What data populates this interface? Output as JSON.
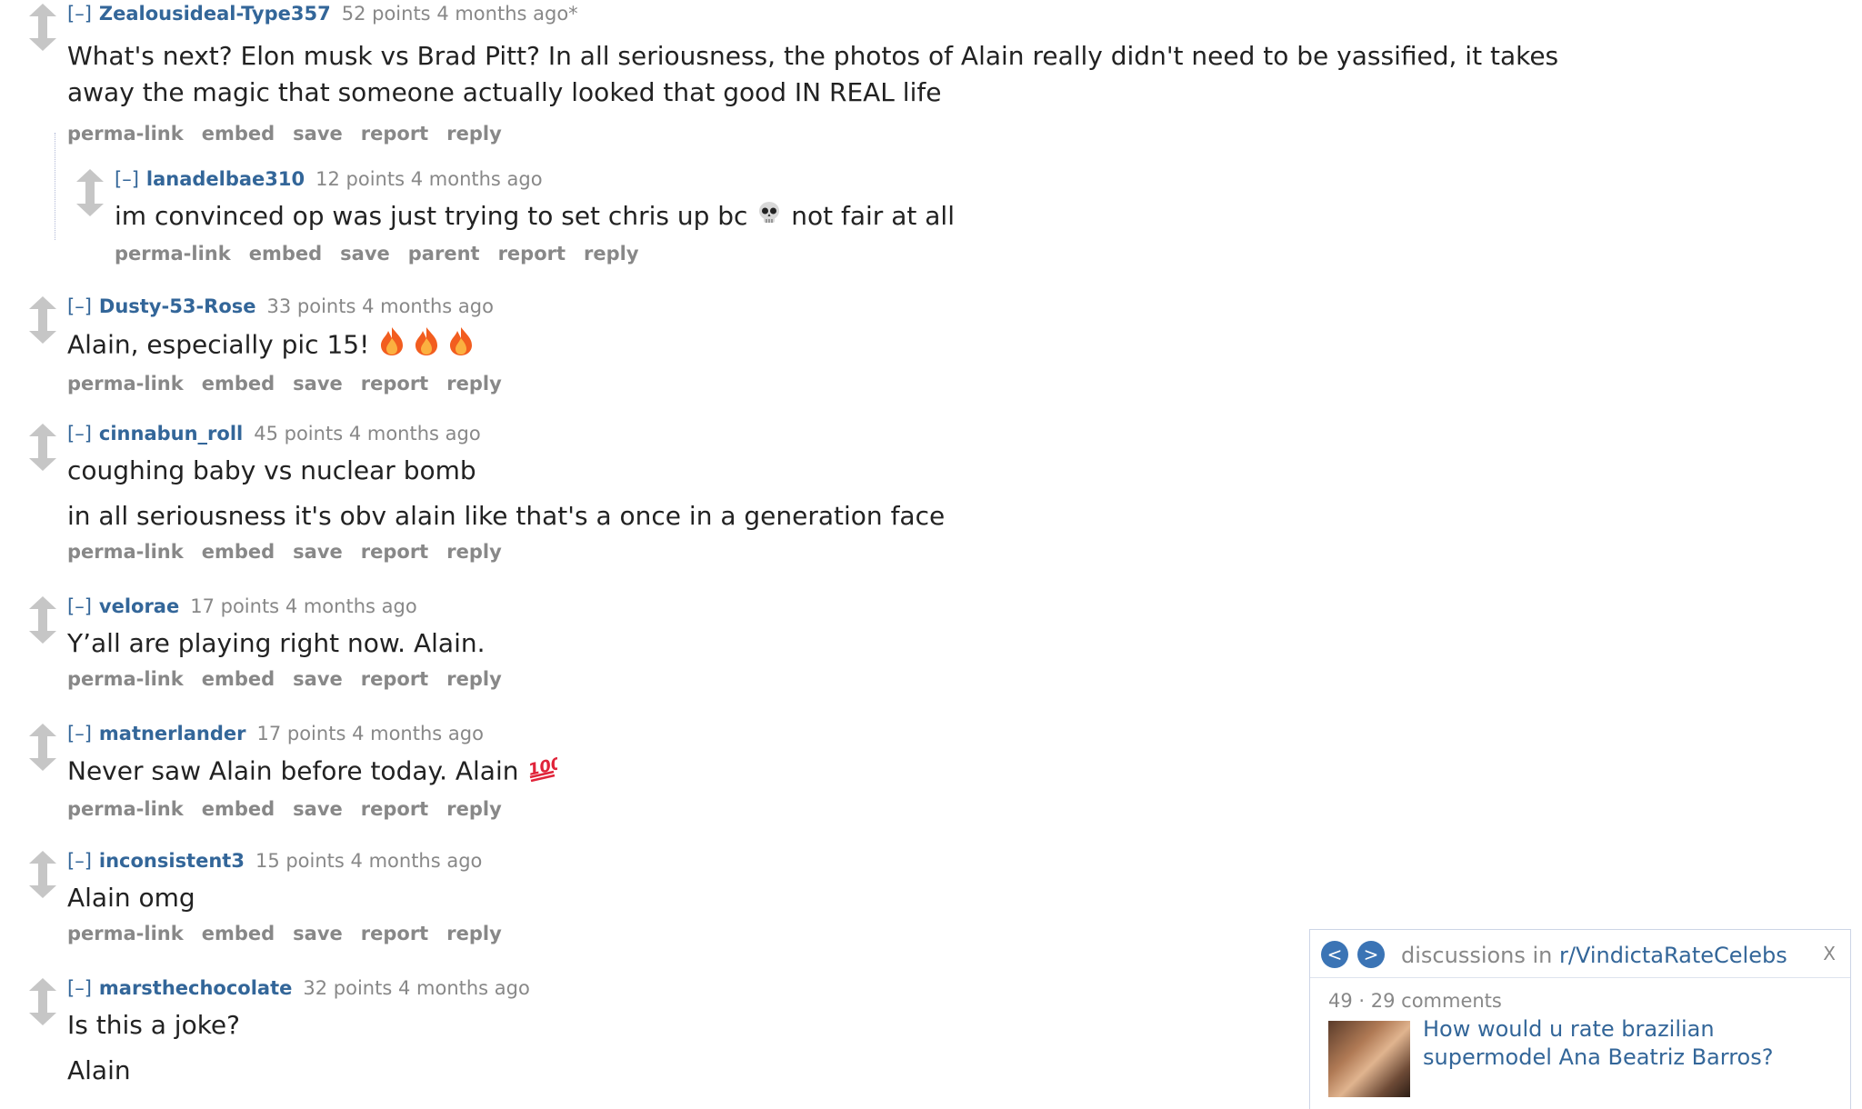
{
  "colors": {
    "link": "#336699",
    "muted": "#888888",
    "arrow": "#c6c6c6",
    "nav_button": "#3b74b5"
  },
  "comments": [
    {
      "collapse": "[–]",
      "author": "Zealousideal-Type357",
      "score": "52 points",
      "time": "4 months ago*",
      "body": [
        "What's next? Elon musk vs Brad Pitt? In all seriousness, the photos of Alain really didn't need to be yassified, it takes away the magic that someone actually looked that good IN REAL life"
      ],
      "actions": [
        "perma-link",
        "embed",
        "save",
        "report",
        "reply"
      ]
    },
    {
      "collapse": "[–]",
      "author": "lanadelbae310",
      "score": "12 points",
      "time": "4 months ago",
      "body_before_emoji": "im convinced op was just trying to set chris up bc",
      "emoji": "skull-emoji",
      "body_after_emoji": "not fair at all",
      "actions": [
        "perma-link",
        "embed",
        "save",
        "parent",
        "report",
        "reply"
      ]
    },
    {
      "collapse": "[–]",
      "author": "Dusty-53-Rose",
      "score": "33 points",
      "time": "4 months ago",
      "body_before_emoji": "Alain, especially pic 15!",
      "emoji": "fire-emoji",
      "actions": [
        "perma-link",
        "embed",
        "save",
        "report",
        "reply"
      ]
    },
    {
      "collapse": "[–]",
      "author": "cinnabun_roll",
      "score": "45 points",
      "time": "4 months ago",
      "body": [
        "coughing baby vs nuclear bomb",
        "in all seriousness it's obv alain like that's a once in a generation face"
      ],
      "actions": [
        "perma-link",
        "embed",
        "save",
        "report",
        "reply"
      ]
    },
    {
      "collapse": "[–]",
      "author": "velorae",
      "score": "17 points",
      "time": "4 months ago",
      "body": [
        "Y’all are playing right now. Alain."
      ],
      "actions": [
        "perma-link",
        "embed",
        "save",
        "report",
        "reply"
      ]
    },
    {
      "collapse": "[–]",
      "author": "matnerlander",
      "score": "17 points",
      "time": "4 months ago",
      "body_before_emoji": "Never saw Alain before today. Alain",
      "emoji": "hundred-emoji",
      "actions": [
        "perma-link",
        "embed",
        "save",
        "report",
        "reply"
      ]
    },
    {
      "collapse": "[–]",
      "author": "inconsistent3",
      "score": "15 points",
      "time": "4 months ago",
      "body": [
        "Alain omg"
      ],
      "actions": [
        "perma-link",
        "embed",
        "save",
        "report",
        "reply"
      ]
    },
    {
      "collapse": "[–]",
      "author": "marsthechocolate",
      "score": "32 points",
      "time": "4 months ago",
      "body": [
        "Is this a joke?",
        "Alain"
      ],
      "actions": [
        "perma-link",
        "embed",
        "save",
        "report",
        "reply"
      ]
    }
  ],
  "discussions": {
    "prev": "<",
    "next": ">",
    "prefix": "discussions in",
    "subreddit": "r/VindictaRateCelebs",
    "close": "X",
    "meta": "49 · 29 comments",
    "title": "How would u rate brazilian supermodel Ana Beatriz Barros?"
  }
}
